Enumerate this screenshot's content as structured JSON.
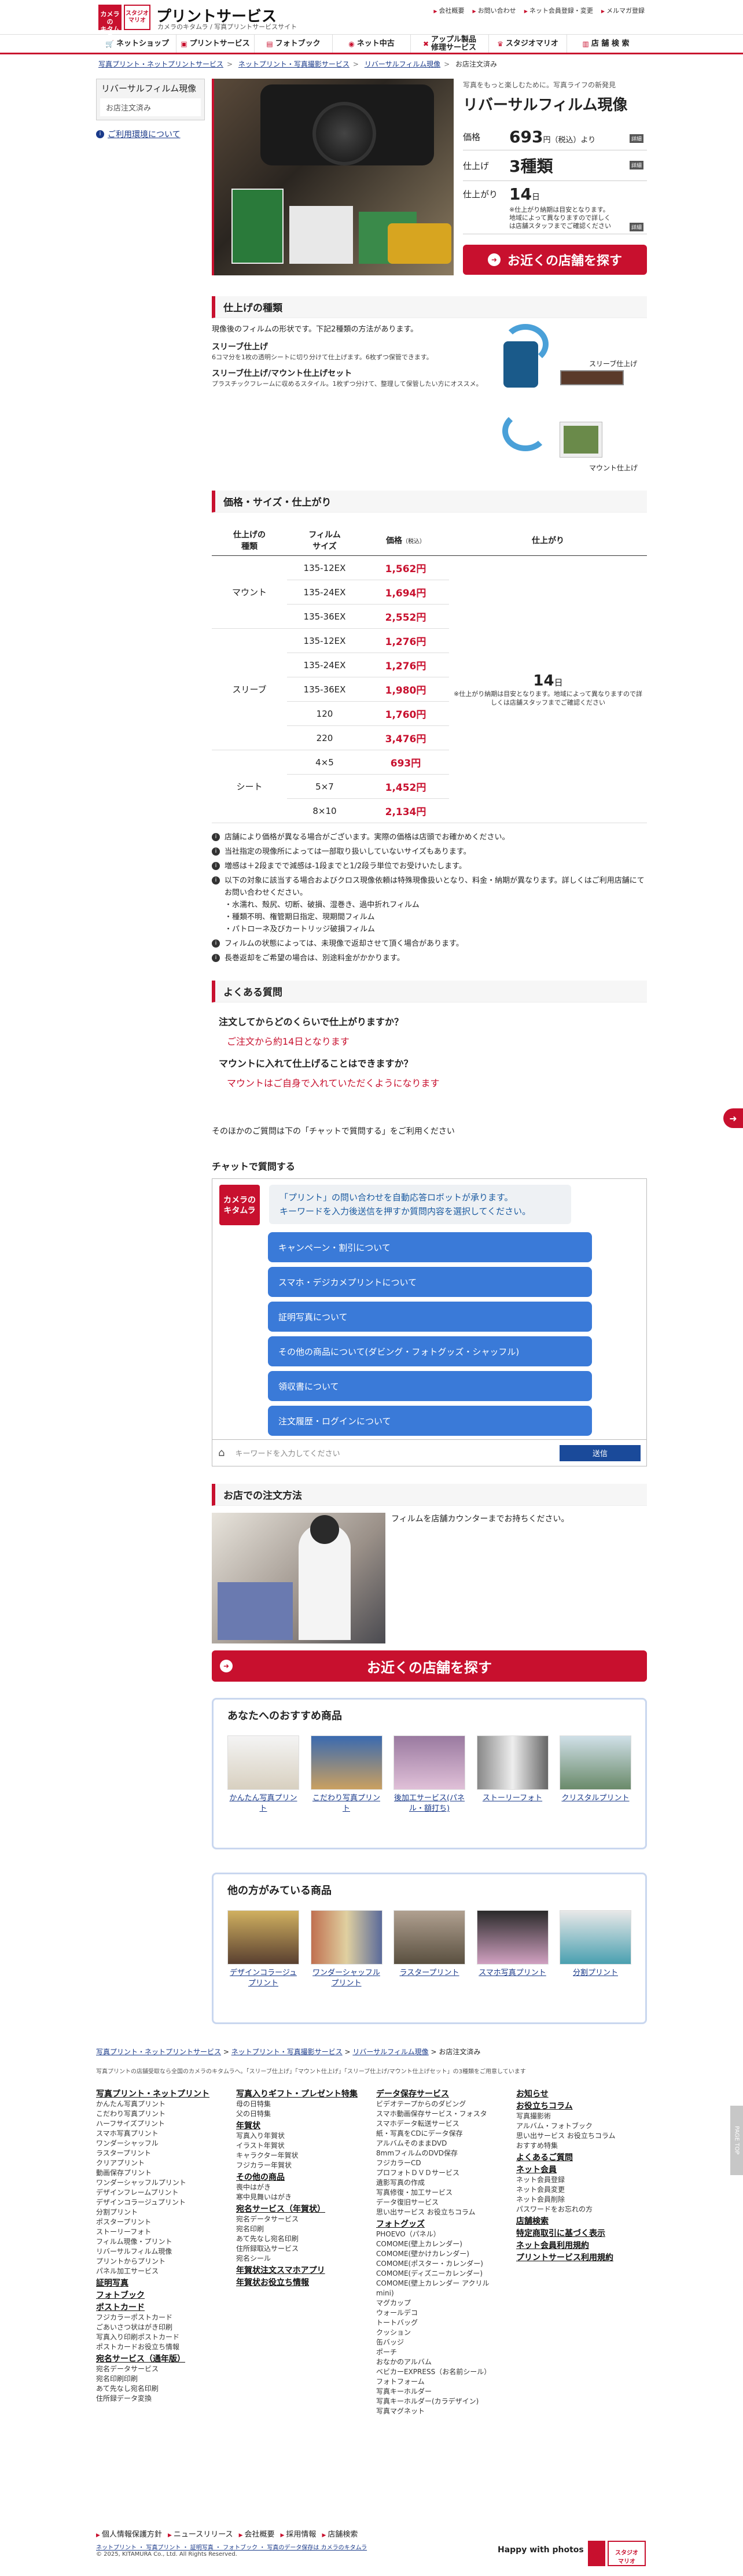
{
  "header": {
    "logo1_text": "カメラの\nキタムラ",
    "logo2_text": "スタジオ\nマリオ",
    "title": "プリントサービス",
    "subtitle": "カメラのキタムラ / 写真プリントサービスサイト",
    "top_links": [
      "会社概要",
      "お問い合わせ",
      "ネット会員登録・変更",
      "メルマガ登録"
    ]
  },
  "nav": [
    {
      "label": "ネットショップ",
      "icon": "cart-icon"
    },
    {
      "label": "プリントサービス",
      "icon": "print-icon"
    },
    {
      "label": "フォトブック",
      "icon": "book-icon"
    },
    {
      "label": "ネット中古",
      "icon": "camera-icon"
    },
    {
      "label": "アップル製品\n修理サービス",
      "icon": "wrench-icon"
    },
    {
      "label": "スタジオマリオ",
      "icon": "studio-icon"
    },
    {
      "label": "店 舗 検 索",
      "icon": "store-icon"
    }
  ],
  "breadcrumb": [
    "写真プリント・ネットプリントサービス",
    "ネットプリント・写真撮影サービス",
    "リバーサルフィルム現像",
    "お店注文済み"
  ],
  "side": {
    "title": "リバーサルフィルム現像",
    "sub": "お店注文済み",
    "link": "ご利用環境について"
  },
  "hero": {
    "sub": "写真をもっと楽しむために。写真ライフの新発見",
    "title": "リバーサルフィルム現像",
    "price_label": "価格",
    "price": "693",
    "price_unit": "円（税込）より",
    "finish_label": "仕上げ",
    "finish": "3種類",
    "days_label": "仕上がり",
    "days": "14",
    "days_unit": "日",
    "days_note": "※仕上がり納期は目安となります。地域によって異なりますので詳しくは店舗スタッフまでご確認ください",
    "tag": "詳細",
    "cta": "お近くの店舗を探す"
  },
  "finish_section": {
    "heading": "仕上げの種類",
    "intro": "現像後のフィルムの形状です。下記2種類の方法があります。",
    "slv_title": "スリーブ仕上げ",
    "slv_desc": "6コマ分を1枚の透明シートに切り分けて仕上げます。6枚ずつ保管できます。",
    "mnt_title": "スリーブ仕上げ/マウント仕上げセット",
    "mnt_desc": "プラスチックフレームに収めるスタイル。1枚ずつ分けて、整理して保管したい方にオススメ。",
    "img_label1": "スリーブ仕上げ",
    "img_label2": "マウント仕上げ"
  },
  "price_section": {
    "heading": "価格・サイズ・仕上がり",
    "headers": [
      "仕上げの\n種類",
      "フィルム\nサイズ",
      "価格",
      "（税込）",
      "仕上がり"
    ],
    "groups": [
      {
        "name": "マウント",
        "rows": [
          [
            "135-12EX",
            "1,562円"
          ],
          [
            "135-24EX",
            "1,694円"
          ],
          [
            "135-36EX",
            "2,552円"
          ]
        ]
      },
      {
        "name": "スリーブ",
        "rows": [
          [
            "135-12EX",
            "1,276円"
          ],
          [
            "135-24EX",
            "1,276円"
          ],
          [
            "135-36EX",
            "1,980円"
          ],
          [
            "120",
            "1,760円"
          ],
          [
            "220",
            "3,476円"
          ]
        ]
      },
      {
        "name": "シート",
        "rows": [
          [
            "4×5",
            "693円"
          ],
          [
            "5×7",
            "1,452円"
          ],
          [
            "8×10",
            "2,134円"
          ]
        ]
      }
    ],
    "days": "14",
    "days_unit": "日",
    "days_note": "※仕上がり納期は目安となります。地域によって異なりますので詳しくは店舗スタッフまでご確認ください"
  },
  "notes": [
    "店舗により価格が異なる場合がございます。実際の価格は店頭でお確かめください。",
    "当社指定の現像所によっては一部取り扱いしていないサイズもあります。",
    "増感は＋2段までで減感は-1段までと1/2段ラ単位でお受けいたします。",
    "以下の対象に該当する場合およびクロス現像依頼は特殊現像扱いとなり、料金・納期が異なります。詳しくはご利用店舗にてお問い合わせください。\n・水濡れ、殻尻、切断、破損、湿巻き、過中折れフィルム\n・種類不明、権管期日指定、現期間フィルム\n・パトローネ及びカートリッジ破損フィルム",
    "フィルムの状態によっては、未現像で返却させて頂く場合があります。",
    "長巻返却をご希望の場合は、別途料金がかかります。"
  ],
  "faq": {
    "heading": "よくある質問",
    "items": [
      {
        "q": "注文してからどのくらいで仕上がりますか？",
        "a": "ご注文から約14日となります"
      },
      {
        "q": "マウントに入れて仕上げることはできますか？",
        "a": "マウントはご自身で入れていただくようになります"
      }
    ],
    "other": "そのほかのご質問は下の「チャットで質問する」をご利用ください"
  },
  "chat": {
    "heading": "チャットで質問する",
    "avatar": "カメラの\nキタムラ",
    "bubble": "「プリント」の問い合わせを自動応答ロボットが承ります。\nキーワードを入力後送信を押すか質問内容を選択してください。",
    "options": [
      "キャンペーン・割引について",
      "スマホ・デジカメプリントについて",
      "証明写真について",
      "その他の商品について(ダビング・フォトグッズ・シャッフル)",
      "領収書について",
      "注文履歴・ログインについて"
    ],
    "placeholder": "キーワードを入力してください",
    "send": "送信"
  },
  "store": {
    "heading": "お店での注文方法",
    "text": "フィルムを店舗カウンターまでお持ちください。",
    "cta": "お近くの店舗を探す"
  },
  "recommend": {
    "heading": "あなたへのおすすめ商品",
    "items": [
      "かんたん写真プリント",
      "こだわり写真プリント",
      "後加工サービス(パネル・額打ち)",
      "ストーリーフォト",
      "クリスタルプリント"
    ]
  },
  "others": {
    "heading": "他の方がみている商品",
    "items": [
      "デザインコラージュプリント",
      "ワンダーシャッフルプリント",
      "ラスタープリント",
      "スマホ写真プリント",
      "分割プリント"
    ]
  },
  "footer": {
    "breadcrumb": [
      "写真プリント・ネットプリントサービス",
      "ネットプリント・写真撮影サービス",
      "リバーサルフィルム現像",
      "お店注文済み"
    ],
    "desc": "写真プリントの店舗受取なら全国のカメラのキタムラへ。「スリーブ仕上げ」「マウント仕上げ」「スリーブ仕上げ/マウント仕上げセット」の3種類をご用意しています",
    "cols": [
      [
        {
          "h": "写真プリント・ネットプリント",
          "l": [
            "かんたん写真プリント",
            "こだわり写真プリント",
            "ハーフサイズプリント",
            "スマホ写真プリント",
            "ワンダーシャッフル",
            "ラスタープリント",
            "クリアプリント",
            "動画保存プリント",
            "ワンダーシャッフルプリント",
            "デザインフレームプリント",
            "デザインコラージュプリント",
            "分割プリント",
            "ポスタープリント",
            "ストーリーフォト",
            "フィルム現像・プリント",
            "リバーサルフィルム現像",
            "プリントからプリント",
            "パネル加工サービス"
          ]
        },
        {
          "h": "証明写真",
          "l": []
        },
        {
          "h": "フォトブック",
          "l": []
        },
        {
          "h": "ポストカード",
          "l": [
            "フジカラーポストカード",
            "ごあいさつ状はがき印刷",
            "写真入り印刷ポストカード",
            "ポストカードお役立ち情報"
          ]
        },
        {
          "h": "宛名サービス（通年版）",
          "l": [
            "宛名データサービス",
            "宛名印刷印刷",
            "あて先なし宛名印刷",
            "住所録データ変換"
          ]
        }
      ],
      [
        {
          "h": "写真入りギフト・プレゼント特集",
          "l": [
            "母の日特集",
            "父の日特集"
          ]
        },
        {
          "h": "年賀状",
          "l": [
            "写真入り年賀状",
            "イラスト年賀状",
            "キャラクター年賀状",
            "フジカラー年賀状"
          ]
        },
        {
          "h": "その他の商品",
          "l": [
            "喪中はがき",
            "寒中見舞いはがき"
          ]
        },
        {
          "h": "宛名サービス（年賀状）",
          "l": [
            "宛名データサービス",
            "宛名印刷",
            "あて先なし宛名印刷",
            "住所録取込サービス",
            "宛名シール"
          ]
        },
        {
          "h": "年賀状注文スマホアプリ",
          "l": []
        },
        {
          "h": "年賀状お役立ち情報",
          "l": []
        }
      ],
      [
        {
          "h": "データ保存サービス",
          "l": [
            "ビデオテープからのダビング",
            "スマホ動画保存サービス・フォスタ"
          ]
        },
        {
          "h": "",
          "l": [
            "スマホデータ転送サービス",
            "紙・写真をCDにデータ保存",
            "アルバムそのままDVD",
            "8mmフィルムのDVD保存",
            "フジカラーCD",
            "プロフォトＤＶＤサービス",
            "遺影写真の作成",
            "写真修復・加工サービス",
            "データ復旧サービス",
            "思い出サービス お役立ちコラム"
          ]
        },
        {
          "h": "フォトグッズ",
          "l": [
            "PHOEVO（パネル）",
            "COMOME(壁上カレンダー)",
            "COMOME(壁かけカレンダー)",
            "COMOME(ポスター・カレンダー)",
            "COMOME(ディズニーカレンダー)",
            "COMOME(壁上カレンダー アクリル mini)",
            "マグカップ",
            "ウォールデコ",
            "トートバッグ",
            "クッション",
            "缶バッジ",
            "ポーチ",
            "おなかのアルバム",
            "ベビカーEXPRESS（お名前シール）",
            "フォトフォーム",
            "写真キーホルダー",
            "写真キーホルダー(カラデザイン)",
            "写真マグネット"
          ]
        }
      ],
      [
        {
          "h": "お知らせ",
          "l": []
        },
        {
          "h": "お役立ちコラム",
          "l": [
            "写真撮影術",
            "アルバム・フォトブック",
            "思い出サービス お役立ちコラム",
            "おすすめ特集"
          ]
        },
        {
          "h": "よくあるご質問",
          "l": []
        },
        {
          "h": "ネット会員",
          "l": [
            "ネット会員登録",
            "ネット会員変更",
            "ネット会員削除",
            "パスワードをお忘れの方"
          ]
        },
        {
          "h": "店舗検索",
          "l": []
        },
        {
          "h": "特定商取引に基づく表示",
          "l": []
        },
        {
          "h": "ネット会員利用規約",
          "l": []
        },
        {
          "h": "プリントサービス利用規約",
          "l": []
        }
      ]
    ],
    "bottom_links": [
      "個人情報保護方針",
      "ニュースリリース",
      "会社概要",
      "採用情報",
      "店舗検索"
    ],
    "copy_links": "ネットプリント ・ 写真プリント ・ 証明写真 ・ フォトブック ・ 写真のデータ保存は カメラのキタムラ",
    "copyright": "© 2025, KITAMURA Co., Ltd. All Rights Reserved.",
    "happy": "Happy with photos",
    "logo2": "スタジオ\nマリオ"
  },
  "colors": {
    "accent": "#c8102e",
    "chat_blue": "#3a7ad8",
    "link": "#1a3a8a"
  }
}
